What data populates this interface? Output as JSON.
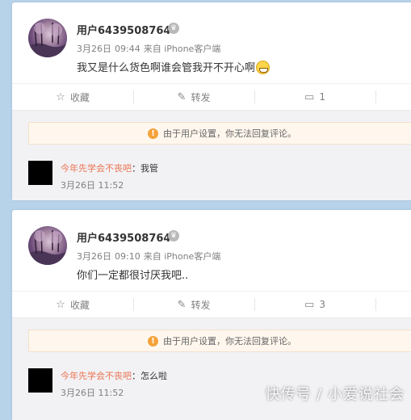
{
  "posts": [
    {
      "username": "用户6439508764",
      "date": "3月26日",
      "time": "09:44",
      "source": "来自 iPhone客户端",
      "text": "我又是什么货色啊谁会管我开不开心啊",
      "actions": {
        "fav": "收藏",
        "repost": "转发",
        "comment_count": "1"
      },
      "notice": "由于用户设置，你无法回复评论。",
      "comment": {
        "user": "今年先学会不丧吧",
        "text": "：我管",
        "time": "3月26日 11:52"
      }
    },
    {
      "username": "用户6439508764",
      "date": "3月26日",
      "time": "09:10",
      "source": "来自 iPhone客户端",
      "text": "你们一定都很讨厌我吧..",
      "actions": {
        "fav": "收藏",
        "repost": "转发",
        "comment_count": "3"
      },
      "notice": "由于用户设置，你无法回复评论。",
      "comment": {
        "user": "今年先学会不丧吧",
        "text": "：怎么啦",
        "time": "3月26日 11:52"
      }
    }
  ],
  "watermark": "快传号 / 小爱说社会",
  "colors": {
    "accent_link": "#eb7350",
    "background": "#b7d3ea",
    "notice_bg": "#fff7ee",
    "warn": "#f4a23a"
  }
}
